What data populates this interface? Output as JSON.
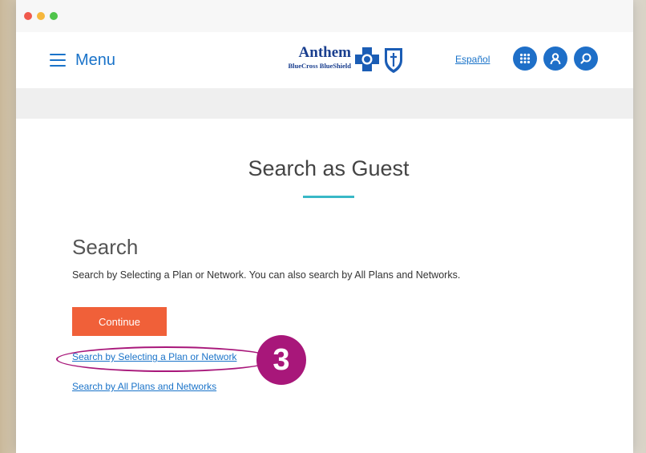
{
  "header": {
    "menu_label": "Menu",
    "logo": {
      "name": "Anthem",
      "subtitle": "BlueCross BlueShield"
    },
    "espanol_label": "Español",
    "icons": [
      "apps-grid-icon",
      "user-profile-icon",
      "search-icon"
    ]
  },
  "main": {
    "page_title": "Search as Guest",
    "section_heading": "Search",
    "section_description": "Search by Selecting a Plan or Network. You can also search by All Plans and Networks.",
    "continue_label": "Continue",
    "link_select_plan": "Search by Selecting a Plan or Network",
    "link_all_plans": "Search by All Plans and Networks"
  },
  "annotation": {
    "step_number": "3"
  },
  "colors": {
    "accent_blue": "#1a73c9",
    "button_orange": "#f06039",
    "annotation_magenta": "#a8177a",
    "title_underline_teal": "#39b8c6"
  }
}
